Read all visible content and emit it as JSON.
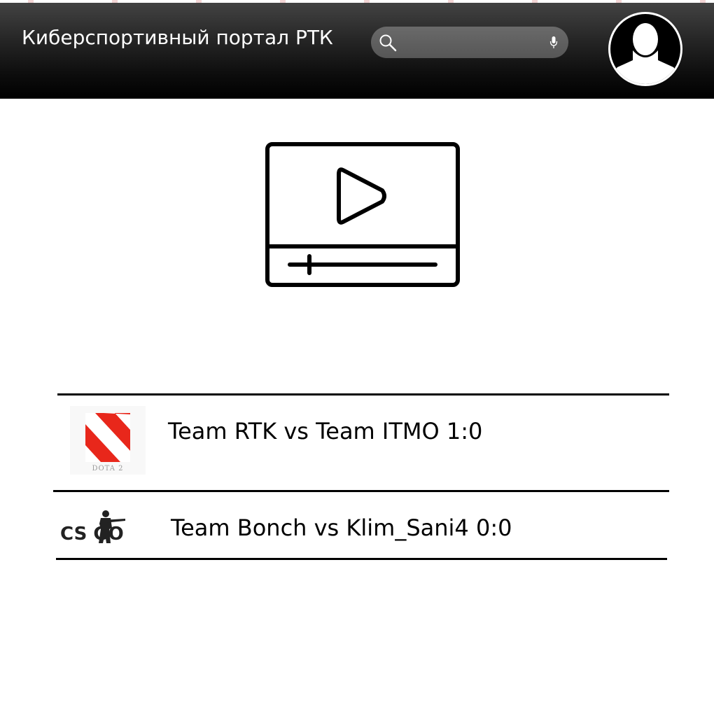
{
  "header": {
    "title": "Киберспортивный портал РТК",
    "search": {
      "value": "",
      "placeholder": ""
    },
    "icons": {
      "search": "search-icon",
      "mic": "microphone-icon",
      "avatar": "user-avatar-icon"
    }
  },
  "video": {
    "icon": "video-player-icon"
  },
  "matches": [
    {
      "game": "DOTA 2",
      "logo": "dota2-logo",
      "text": "Team RTK vs Team ITMO 1:0"
    },
    {
      "game": "CS GO",
      "logo": "csgo-logo",
      "text": "Team Bonch vs Klim_Sani4 0:0"
    }
  ],
  "colors": {
    "header_bg": "#000000",
    "dota_red": "#e8271b",
    "search_bg": "#5f5f5f"
  }
}
